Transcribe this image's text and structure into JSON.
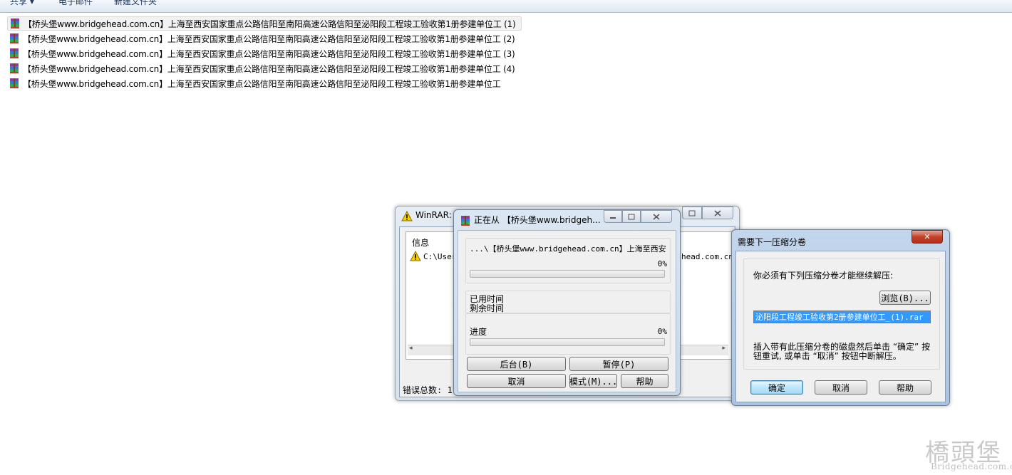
{
  "toolbar": {
    "share": "共享 ▾",
    "email": "电子邮件",
    "new_folder": "新建文件夹"
  },
  "files": [
    {
      "name": "【桥头堡www.bridgehead.com.cn】上海至西安国家重点公路信阳至南阳高速公路信阳至泌阳段工程竣工验收第1册参建单位工 (1)",
      "icon": "winrar-archive-icon"
    },
    {
      "name": "【桥头堡www.bridgehead.com.cn】上海至西安国家重点公路信阳至南阳高速公路信阳至泌阳段工程竣工验收第1册参建单位工 (2)",
      "icon": "winrar-archive-icon"
    },
    {
      "name": "【桥头堡www.bridgehead.com.cn】上海至西安国家重点公路信阳至南阳高速公路信阳至泌阳段工程竣工验收第1册参建单位工 (3)",
      "icon": "winrar-archive-icon"
    },
    {
      "name": "【桥头堡www.bridgehead.com.cn】上海至西安国家重点公路信阳至南阳高速公路信阳至泌阳段工程竣工验收第1册参建单位工 (4)",
      "icon": "winrar-archive-icon"
    },
    {
      "name": "【桥头堡www.bridgehead.com.cn】上海至西安国家重点公路信阳至南阳高速公路信阳至泌阳段工程竣工验收第1册参建单位工",
      "icon": "winrar-archive-icon"
    }
  ],
  "winrar_diag": {
    "title": "WinRAR:",
    "col_info": "信息",
    "path_left": "C:\\User",
    "path_right": "head.com.cn",
    "error_total": "错误总数:  1"
  },
  "extract": {
    "title": "正在从 【桥头堡www.bridgeh...",
    "file_path": "...\\【桥头堡www.bridgehead.com.cn】上海至西安国",
    "file_percent": "0%",
    "file_progress": 0,
    "elapsed_label": "已用时间",
    "remaining_label": "剩余时间",
    "progress_label": "进度",
    "total_percent": "0%",
    "total_progress": 0,
    "btn_background": "后台(B)",
    "btn_pause": "暂停(P)",
    "btn_cancel": "取消",
    "btn_mode": "模式(M)...",
    "btn_help": "帮助"
  },
  "next_volume": {
    "title": "需要下一压缩分卷",
    "message": "你必须有下列压缩分卷才能继续解压:",
    "browse": "浏览(B)...",
    "volume_name": "泌阳段工程竣工验收第2册参建单位工_(1).rar",
    "instruction_1": "插入带有此压缩分卷的磁盘然后单击 “确定” 按",
    "instruction_2": "钮重试, 或单击 “取消” 按钮中断解压。",
    "ok": "确定",
    "cancel": "取消",
    "help": "帮助",
    "close": "✕"
  },
  "watermark": {
    "logo": "橋頭堡",
    "url": "Bridgehead.com.cn"
  },
  "colors": {
    "selection": "#3399ff",
    "title_bar": "#c9d8e9",
    "progress_fill": "#37b24d"
  }
}
